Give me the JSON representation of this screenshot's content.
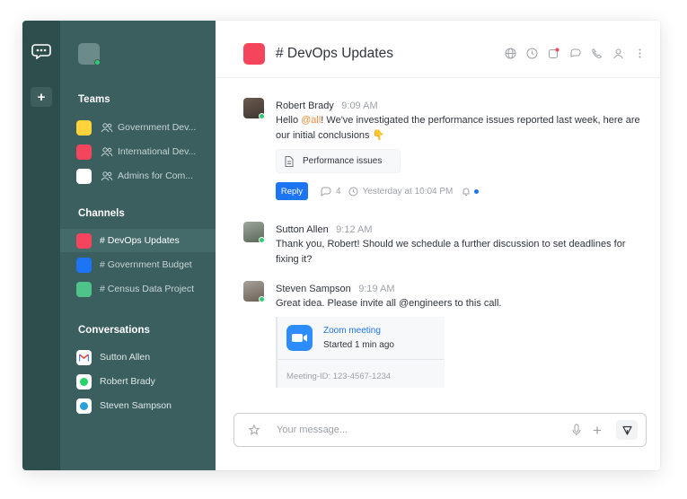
{
  "sidebar": {
    "teams_title": "Teams",
    "teams": [
      {
        "label": "Government Dev...",
        "color": "#ffd43b"
      },
      {
        "label": "International Dev...",
        "color": "#f5455c"
      },
      {
        "label": "Admins for Com...",
        "color": "#ffffff"
      }
    ],
    "channels_title": "Channels",
    "channels": [
      {
        "label": "# DevOps Updates",
        "color": "#f5455c",
        "active": true
      },
      {
        "label": "# Government Budget",
        "color": "#1d74f5",
        "active": false
      },
      {
        "label": "# Census Data Project",
        "color": "#4fc48a",
        "active": false
      }
    ],
    "conversations_title": "Conversations",
    "conversations": [
      {
        "label": "Sutton Allen",
        "icon": "gmail-icon"
      },
      {
        "label": "Robert Brady",
        "icon": "whatsapp-icon"
      },
      {
        "label": "Steven Sampson",
        "icon": "telegram-icon"
      }
    ]
  },
  "header": {
    "title": "# DevOps Updates",
    "icons": [
      "globe-icon",
      "clock-icon",
      "notification-icon",
      "threads-icon",
      "call-icon",
      "members-icon",
      "kebab-icon"
    ]
  },
  "messages": [
    {
      "name": "Robert Brady",
      "time": "9:09 AM",
      "text_before": "Hello ",
      "mention": "@all",
      "text_after": "! We've investigated the performance issues reported last week, here are our initial conclusions 👇",
      "attachment": "Performance issues",
      "reply_label": "Reply",
      "thread_count": "4",
      "thread_time": "Yesterday at 10:04 PM"
    },
    {
      "name": "Sutton Allen",
      "time": "9:12 AM",
      "text": "Thank you, Robert! Should we schedule a further discussion to set deadlines for fixing it?"
    },
    {
      "name": "Steven Sampson",
      "time": "9:19 AM",
      "text": "Great idea. Please invite all @engineers to this call.",
      "zoom": {
        "title": "Zoom meeting",
        "subtitle": "Started 1 min ago",
        "meeting_id": "Meeting-ID: 123-4567-1234"
      }
    }
  ],
  "composer": {
    "placeholder": "Your message..."
  },
  "colors": {
    "rail": "#2e4d4d",
    "sidebar": "#3b5e5e",
    "accent": "#1d74f5",
    "channel": "#f5455c"
  }
}
